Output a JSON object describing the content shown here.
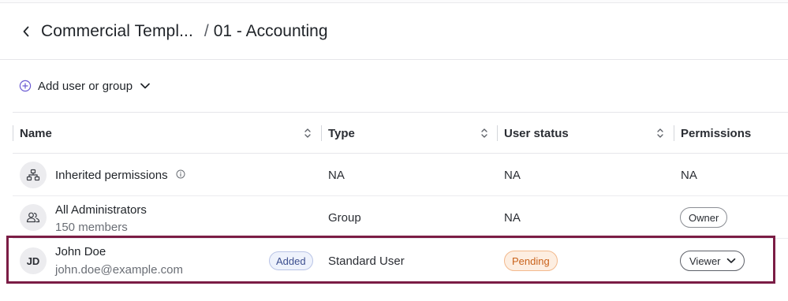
{
  "header": {
    "parent": "Commercial Templ...",
    "separator": "/",
    "current": "01 - Accounting"
  },
  "add": {
    "label": "Add user or group"
  },
  "table": {
    "columns": [
      "Name",
      "Type",
      "User status",
      "Permissions"
    ],
    "rows": [
      {
        "name": "Inherited permissions",
        "sub": "",
        "type": "NA",
        "status": "NA",
        "permission": "NA",
        "icon": "hierarchy-icon"
      },
      {
        "name": "All Administrators",
        "sub": "150 members",
        "type": "Group",
        "status": "NA",
        "permission": "Owner",
        "icon": "group-icon"
      },
      {
        "name": "John Doe",
        "sub": "john.doe@example.com",
        "initials": "JD",
        "badge": "Added",
        "type": "Standard User",
        "status": "Pending",
        "permission": "Viewer"
      }
    ]
  },
  "colors": {
    "highlight": "#7b1d45",
    "pending": "#c9621b",
    "added": "#3d4f8f",
    "accent": "#6b5bd2"
  }
}
